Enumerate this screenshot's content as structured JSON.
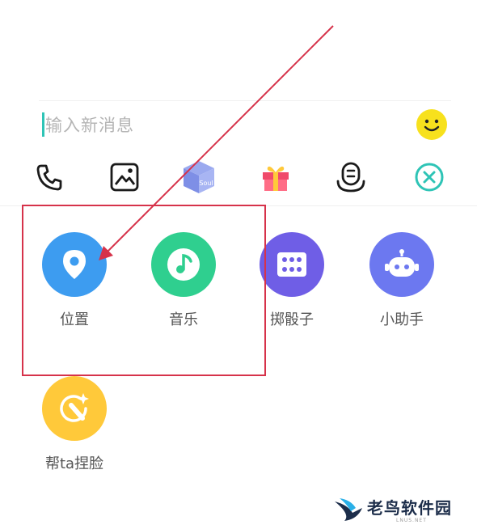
{
  "input": {
    "placeholder": "输入新消息"
  },
  "toolbar": {
    "items": [
      {
        "icon": "phone-icon"
      },
      {
        "icon": "image-icon"
      },
      {
        "icon": "soul-box-icon",
        "text": "Soul"
      },
      {
        "icon": "gift-icon"
      },
      {
        "icon": "voice-robot-icon"
      },
      {
        "icon": "close-icon"
      }
    ]
  },
  "apps": [
    {
      "label": "位置",
      "icon": "location-pin-icon",
      "color": "#3d9cf0"
    },
    {
      "label": "音乐",
      "icon": "music-note-icon",
      "color": "#2fcf8f"
    },
    {
      "label": "掷骰子",
      "icon": "dice-icon",
      "color": "#6f5ee6"
    },
    {
      "label": "小助手",
      "icon": "robot-icon",
      "color": "#6c78f0"
    },
    {
      "label": "帮ta捏脸",
      "icon": "magic-wand-icon",
      "color": "#ffc93a"
    }
  ],
  "colors": {
    "accent": "#2ec4b6",
    "annotation": "#d6324a"
  },
  "watermark": {
    "title": "老鸟软件园",
    "subtitle": "LNUS.NET"
  }
}
